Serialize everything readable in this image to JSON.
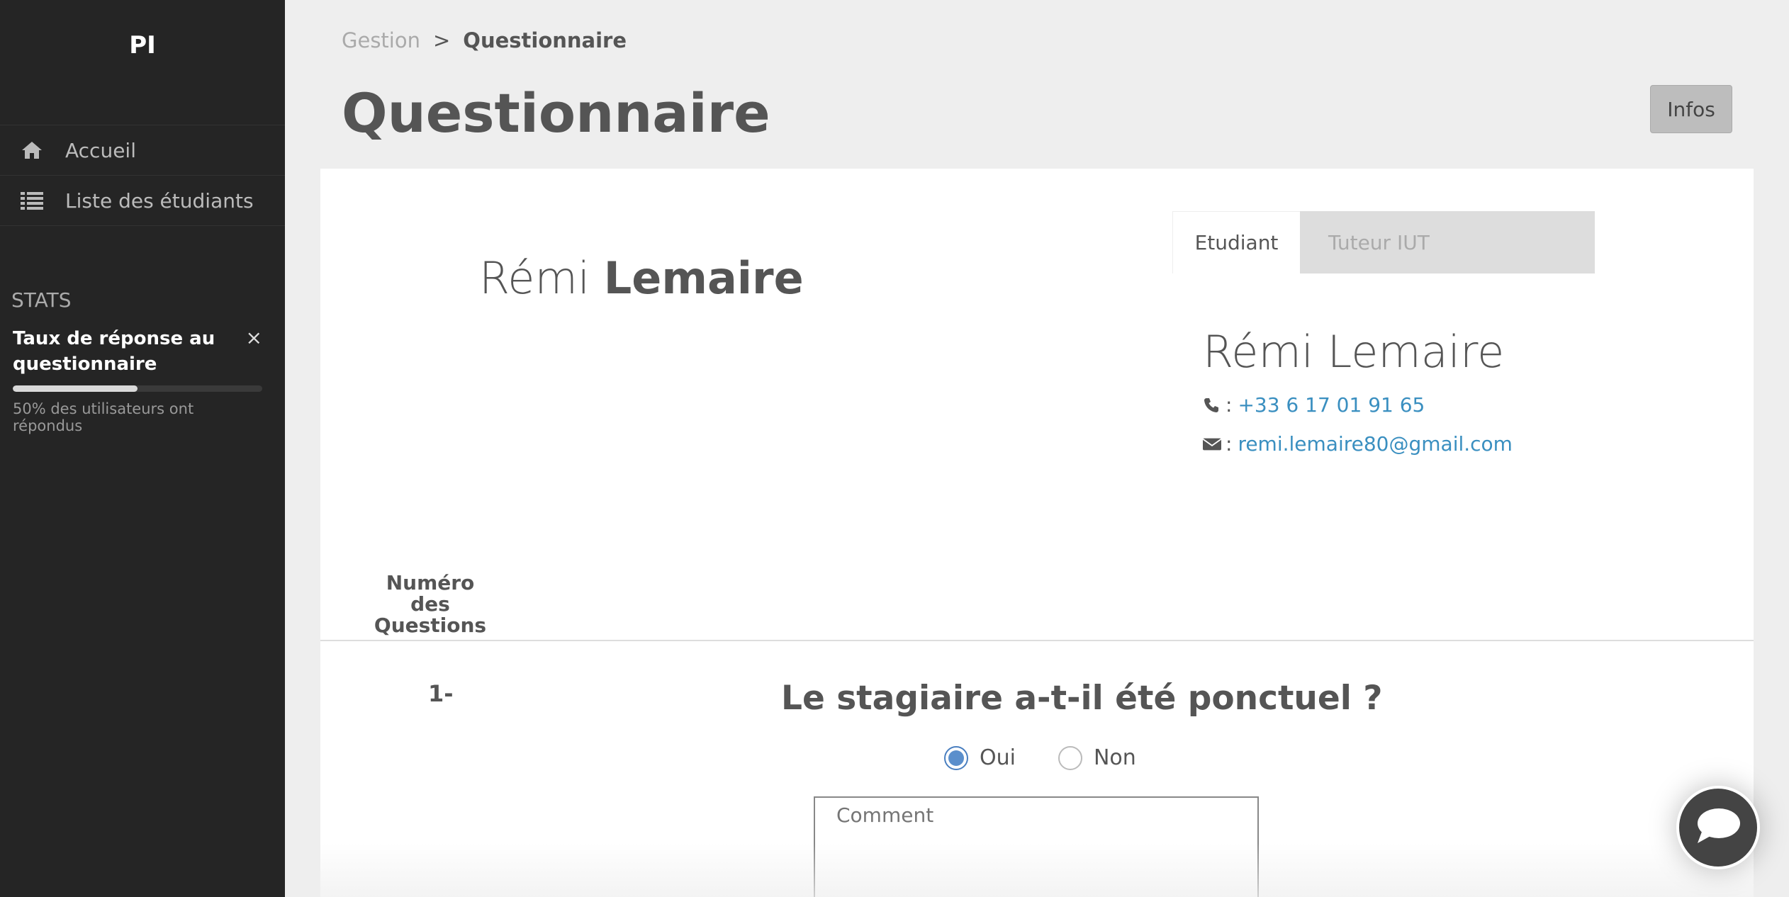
{
  "sidebar": {
    "brand": "PI",
    "items": [
      {
        "label": "Accueil",
        "icon": "home-icon"
      },
      {
        "label": "Liste des étudiants",
        "icon": "list-icon"
      }
    ],
    "stats_title": "STATS",
    "stat": {
      "label": "Taux de réponse au questionnaire",
      "close": "×",
      "progress_percent": 50,
      "subtext": "50% des utilisateurs ont répondus"
    }
  },
  "header": {
    "breadcrumb": {
      "parent": "Gestion",
      "separator": ">",
      "current": "Questionnaire"
    },
    "title": "Questionnaire",
    "infos_button": "Infos"
  },
  "profile": {
    "first_name": "Rémi",
    "last_name": "Lemaire",
    "tabs": [
      {
        "label": "Etudiant",
        "active": true
      },
      {
        "label": "Tuteur IUT",
        "active": false
      }
    ],
    "contact": {
      "name": "Rémi Lemaire",
      "phone_prefix": ":",
      "phone": "+33 6 17 01 91 65",
      "email_prefix": ":",
      "email": "remi.lemaire80@gmail.com"
    }
  },
  "questions": {
    "number_header": "Numéro des Questions",
    "items": [
      {
        "number": "1-",
        "text": "Le stagiaire a-t-il été ponctuel ?",
        "options": [
          {
            "label": "Oui",
            "checked": true
          },
          {
            "label": "Non",
            "checked": false
          }
        ],
        "comment_placeholder": "Comment"
      }
    ]
  },
  "colors": {
    "sidebar_bg": "#252525",
    "link": "#3a8fc0",
    "radio_checked": "#5b8fcc"
  }
}
